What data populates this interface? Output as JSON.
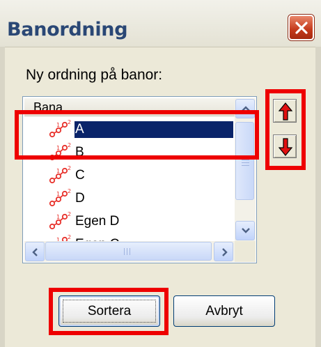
{
  "window": {
    "title": "Banordning",
    "close_icon": "close-icon"
  },
  "prompt_label": "Ny ordning på banor:",
  "list": {
    "column_header": "Bana",
    "items": [
      {
        "label": "A",
        "icon": "course-icon",
        "selected": true
      },
      {
        "label": "B",
        "icon": "course-icon",
        "selected": false
      },
      {
        "label": "C",
        "icon": "course-icon",
        "selected": false
      },
      {
        "label": "D",
        "icon": "course-icon",
        "selected": false
      },
      {
        "label": "Egen D",
        "icon": "course-icon",
        "selected": false
      },
      {
        "label": "Egen C",
        "icon": "course-icon",
        "selected": false
      }
    ]
  },
  "buttons": {
    "sort_label": "Sortera",
    "cancel_label": "Avbryt"
  },
  "icons": {
    "move_up": "red-up-arrow-icon",
    "move_down": "red-down-arrow-icon"
  },
  "colors": {
    "selection": "#0a246a",
    "highlight": "#ee0000",
    "title_text": "#2a4775",
    "close_button": "#c4391a",
    "course_icon": "#e8322c"
  }
}
